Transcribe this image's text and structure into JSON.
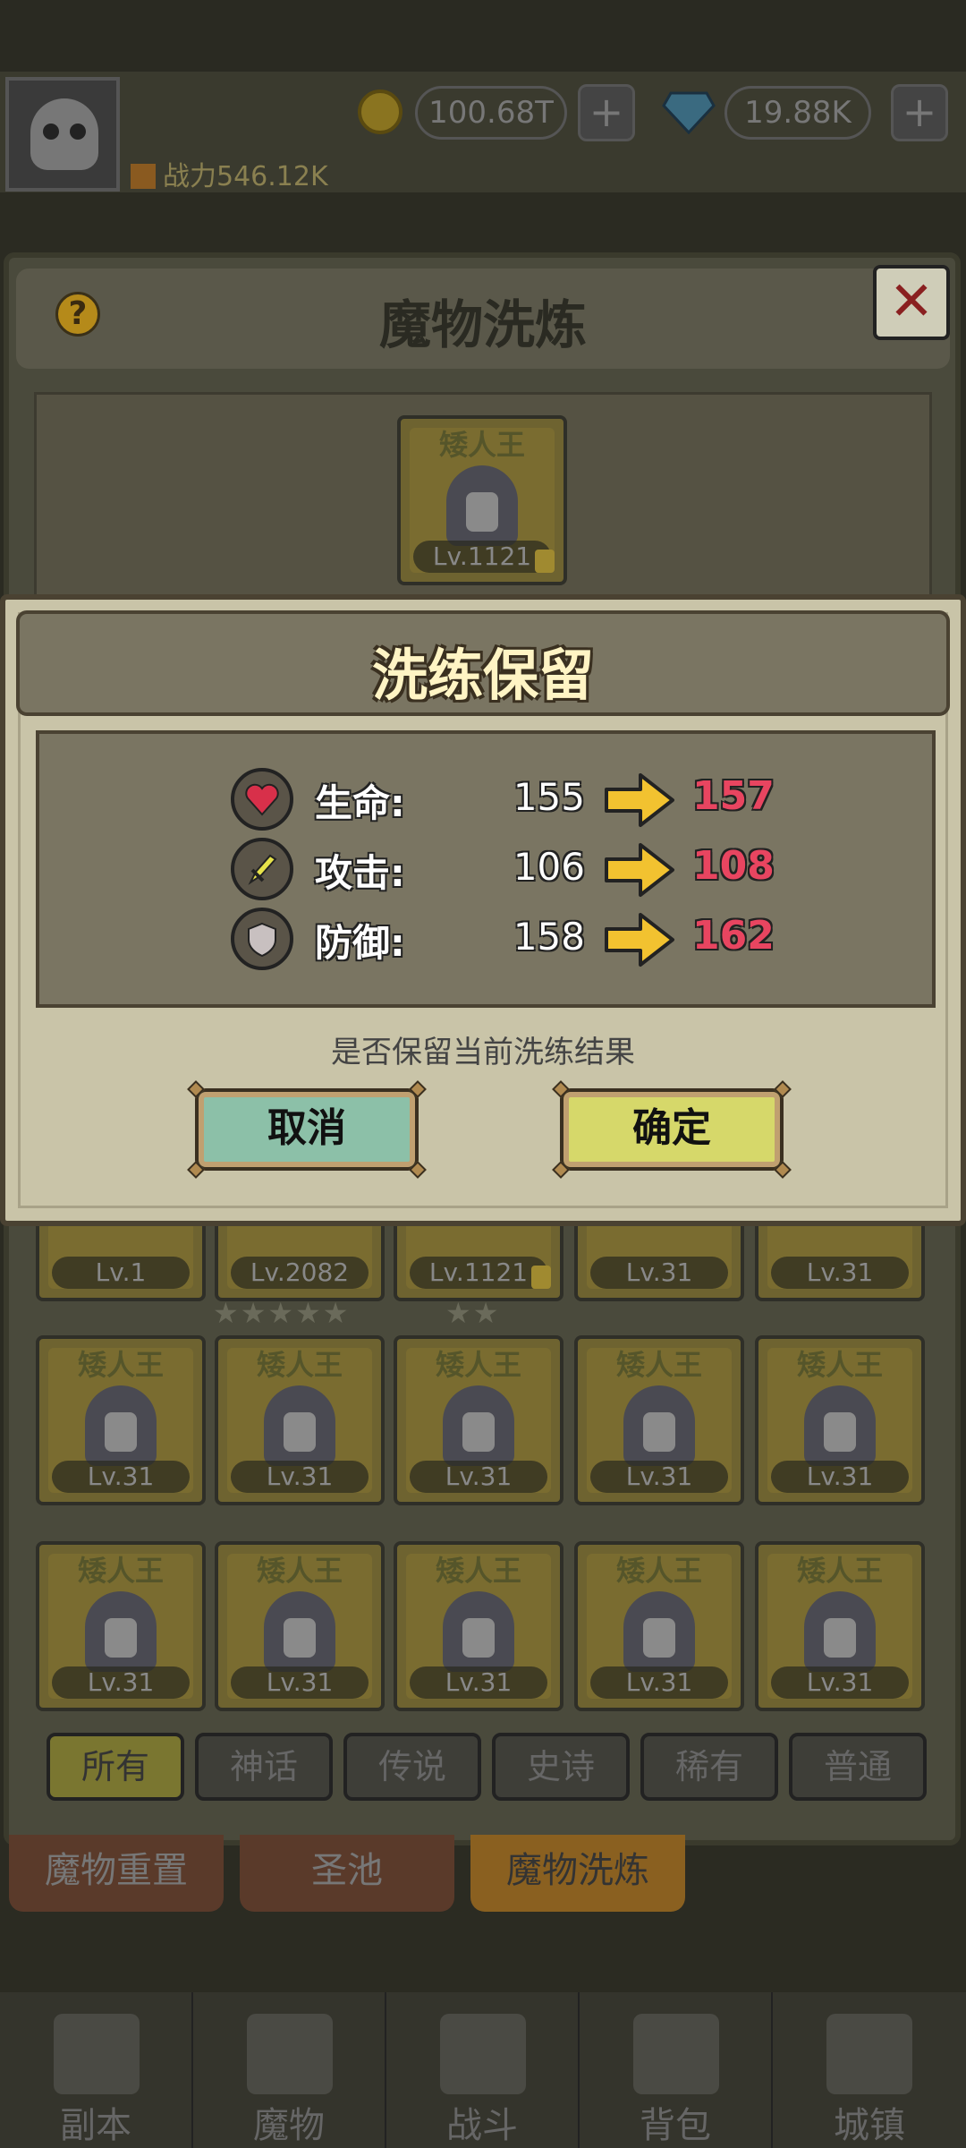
{
  "topbar": {
    "player_name": "",
    "gold": "100.68T",
    "gems": "19.88K",
    "power": "战力546.12K"
  },
  "panel": {
    "title": "魔物洗炼",
    "help": "?",
    "close": "✕",
    "featured_card": {
      "name": "矮人王",
      "level": "Lv.1121",
      "locked": true
    }
  },
  "grid": {
    "row0": [
      {
        "level": "Lv.1"
      },
      {
        "level": "Lv.2082"
      },
      {
        "level": "Lv.1121"
      },
      {
        "level": "Lv.31"
      },
      {
        "level": "Lv.31"
      }
    ],
    "row0_stars": {
      "card1": "★★★★★",
      "card2": "★★"
    },
    "row1": [
      {
        "name": "矮人王",
        "level": "Lv.31"
      },
      {
        "name": "矮人王",
        "level": "Lv.31"
      },
      {
        "name": "矮人王",
        "level": "Lv.31"
      },
      {
        "name": "矮人王",
        "level": "Lv.31"
      },
      {
        "name": "矮人王",
        "level": "Lv.31"
      }
    ],
    "row2": [
      {
        "name": "矮人王",
        "level": "Lv.31"
      },
      {
        "name": "矮人王",
        "level": "Lv.31"
      },
      {
        "name": "矮人王",
        "level": "Lv.31"
      },
      {
        "name": "矮人王",
        "level": "Lv.31"
      },
      {
        "name": "矮人王",
        "level": "Lv.31"
      }
    ]
  },
  "filters": [
    "所有",
    "神话",
    "传说",
    "史诗",
    "稀有",
    "普通"
  ],
  "subtabs": [
    "魔物重置",
    "圣池",
    "魔物洗炼"
  ],
  "bottom_nav": [
    "副本",
    "魔物",
    "战斗",
    "背包",
    "城镇"
  ],
  "modal": {
    "title": "洗练保留",
    "stats": [
      {
        "label": "生命:",
        "old": "155",
        "new": "157",
        "icon": "heart-icon"
      },
      {
        "label": "攻击:",
        "old": "106",
        "new": "108",
        "icon": "sword-icon"
      },
      {
        "label": "防御:",
        "old": "158",
        "new": "162",
        "icon": "shield-icon"
      }
    ],
    "question": "是否保留当前洗练结果",
    "cancel": "取消",
    "confirm": "确定"
  },
  "colors": {
    "new_value": "#e84560",
    "arrow": "#f2c230",
    "confirm_btn": "#d6d86a",
    "cancel_btn": "#8cc0a8"
  }
}
